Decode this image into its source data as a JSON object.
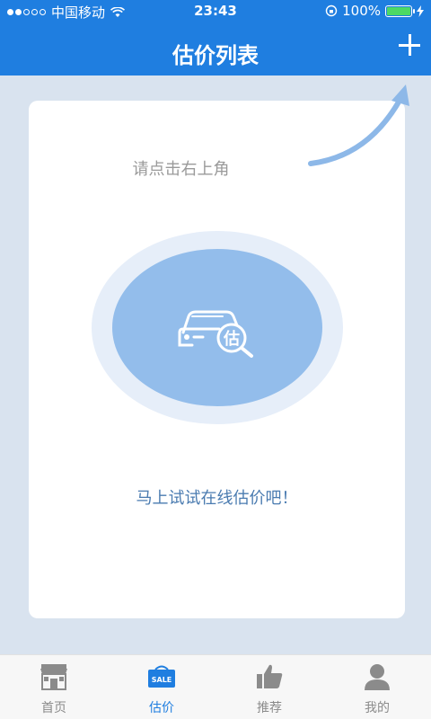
{
  "status_bar": {
    "carrier": "中国移动",
    "time": "23:43",
    "battery": "100%"
  },
  "nav": {
    "title": "估价列表"
  },
  "card": {
    "hint": "请点击右上角",
    "cta": "马上试试在线估价吧！",
    "icon_char": "估"
  },
  "tabs": [
    {
      "label": "首页",
      "icon": "store-icon"
    },
    {
      "label": "估价",
      "icon": "sale-tag-icon",
      "active": true,
      "badge": "SALE"
    },
    {
      "label": "推荐",
      "icon": "thumbs-up-icon"
    },
    {
      "label": "我的",
      "icon": "user-icon"
    }
  ],
  "colors": {
    "primary": "#1f7ee0",
    "circle_inner": "#93bdeb",
    "circle_outer": "#e6eef9",
    "background": "#d9e3ef"
  }
}
